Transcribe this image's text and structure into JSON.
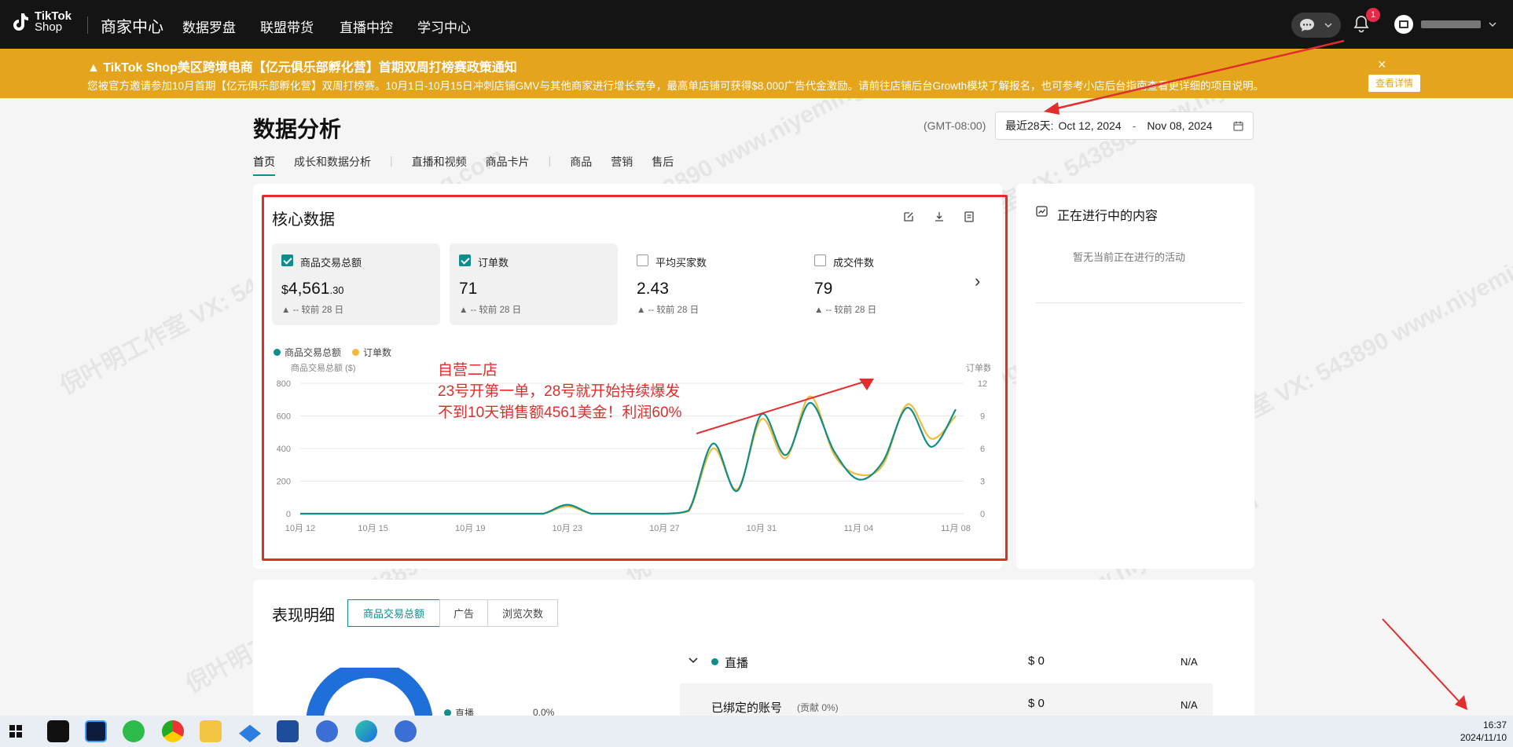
{
  "topnav": {
    "logo_line1": "TikTok",
    "logo_line2": "Shop",
    "brand": "商家中心",
    "items": [
      "数据罗盘",
      "联盟带货",
      "直播中控",
      "学习中心"
    ],
    "notification_count": "1"
  },
  "banner": {
    "title": "▲ TikTok Shop美区跨境电商【亿元俱乐部孵化营】首期双周打榜赛政策通知",
    "body": "您被官方邀请参加10月首期【亿元俱乐部孵化营】双周打榜赛。10月1日-10月15日冲刺店铺GMV与其他商家进行增长竞争，最高单店铺可获得$8,000广告代金激励。请前往店铺后台Growth模块了解报名，也可参考小店后台指南查看更详细的项目说明。",
    "close": "×",
    "detail_button": "查看详情"
  },
  "page": {
    "title": "数据分析",
    "timezone": "(GMT-08:00)",
    "date_prefix": "最近28天:",
    "date_start": "Oct 12, 2024",
    "date_sep": "-",
    "date_end": "Nov 08, 2024",
    "tabs": [
      "首页",
      "成长和数据分析",
      "直播和视频",
      "商品卡片",
      "商品",
      "营销",
      "售后"
    ]
  },
  "core": {
    "title": "核心数据",
    "metrics": [
      {
        "label": "商品交易总额",
        "currency": "$",
        "value_main": "4,561",
        "value_dec": ".30",
        "compare": "▲ --  较前 28 日",
        "checked": true
      },
      {
        "label": "订单数",
        "value_main": "71",
        "compare": "▲ --  较前 28 日",
        "checked": true
      },
      {
        "label": "平均买家数",
        "value_main": "2.43",
        "compare": "▲ --  较前 28 日",
        "checked": false
      },
      {
        "label": "成交件数",
        "value_main": "79",
        "compare": "▲ --  较前 28 日",
        "checked": false
      }
    ],
    "next_arrow": "›"
  },
  "chart_data": {
    "type": "line",
    "title": "",
    "x": [
      "10月 12",
      "10月 13",
      "10月 14",
      "10月 15",
      "10月 16",
      "10月 17",
      "10月 18",
      "10月 19",
      "10月 20",
      "10月 21",
      "10月 22",
      "10月 23",
      "10月 24",
      "10月 25",
      "10月 26",
      "10月 27",
      "10月 28",
      "10月 29",
      "10月 30",
      "10月 31",
      "11月 01",
      "11月 02",
      "11月 03",
      "11月 04",
      "11月 05",
      "11月 06",
      "11月 07",
      "11月 08"
    ],
    "tick_labels": [
      "10月 12",
      "10月 15",
      "10月 19",
      "10月 23",
      "10月 27",
      "10月 31",
      "11月 04",
      "11月 08"
    ],
    "ylabel_left": "商品交易总额 ($)",
    "ylabel_right": "订单数",
    "ylim_left": [
      0,
      800
    ],
    "ylim_right": [
      0,
      12
    ],
    "yticks_left": [
      "0",
      "200",
      "400",
      "600",
      "800"
    ],
    "yticks_right": [
      "0",
      "3",
      "6",
      "9",
      "12"
    ],
    "series": [
      {
        "name": "商品交易总额",
        "axis": "left",
        "color": "#0f8d8a",
        "values": [
          0,
          0,
          0,
          0,
          0,
          0,
          0,
          0,
          0,
          0,
          0,
          55,
          0,
          0,
          0,
          0,
          20,
          430,
          140,
          610,
          360,
          680,
          380,
          210,
          320,
          650,
          410,
          640
        ]
      },
      {
        "name": "订单数",
        "axis": "left",
        "color": "#f3bb3c",
        "values": [
          0,
          0,
          0,
          0,
          0,
          0,
          0,
          0,
          0,
          0,
          0,
          45,
          0,
          0,
          0,
          0,
          15,
          400,
          150,
          580,
          340,
          720,
          360,
          240,
          300,
          670,
          460,
          600
        ]
      }
    ],
    "grid": true,
    "legend": "top-left"
  },
  "annotation": {
    "line1": "自营二店",
    "line2": "23号开第一单，28号就开始持续爆发",
    "line3": "不到10天销售额4561美金！利润60%"
  },
  "ongoing": {
    "title": "正在进行中的内容",
    "empty": "暂无当前正在进行的活动"
  },
  "performance": {
    "title": "表现明细",
    "segments": [
      "商品交易总额",
      "广告",
      "浏览次数"
    ],
    "rows": [
      {
        "label": "直播",
        "value": "$ 0",
        "pct": "N/A"
      },
      {
        "label": "已绑定的账号",
        "sub": "(贡献 0%)",
        "value": "$ 0",
        "pct": "N/A"
      }
    ],
    "donut_legend_label": "直播",
    "donut_legend_pct": "0.0%"
  },
  "taskbar": {
    "time": "16:37",
    "date": "2024/11/10"
  },
  "watermark": "倪叶明工作室 VX: 543890 www.niyeming.com"
}
